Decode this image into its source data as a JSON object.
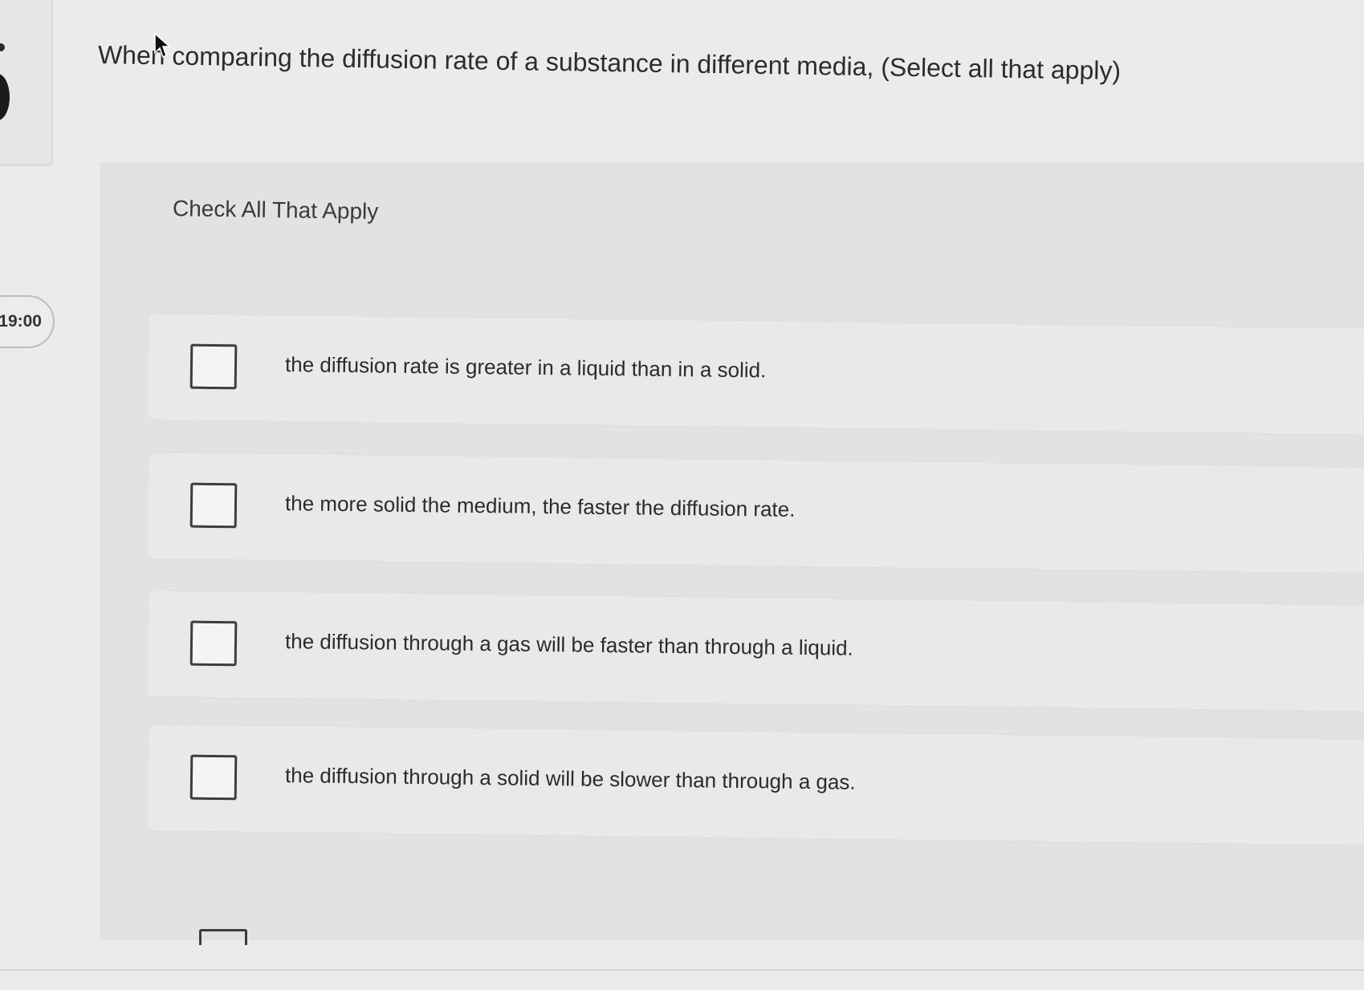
{
  "timer": {
    "text": "19:00"
  },
  "question": {
    "text": "When comparing the diffusion rate of a substance in different media, (Select all that apply)"
  },
  "instruction": {
    "text": "Check All That Apply"
  },
  "options": [
    {
      "text": "the diffusion rate is greater in a liquid than in a solid.",
      "checked": false
    },
    {
      "text": "the more solid the medium, the faster the diffusion rate.",
      "checked": false
    },
    {
      "text": "the diffusion through a gas will be faster than through a liquid.",
      "checked": false
    },
    {
      "text": "the diffusion through a solid will be slower than through a gas.",
      "checked": false
    }
  ],
  "colors": {
    "background": "#ebebeb",
    "panel": "#e2e2e2",
    "checkbox_border": "#3b3d40",
    "text": "#2b2b2b"
  }
}
